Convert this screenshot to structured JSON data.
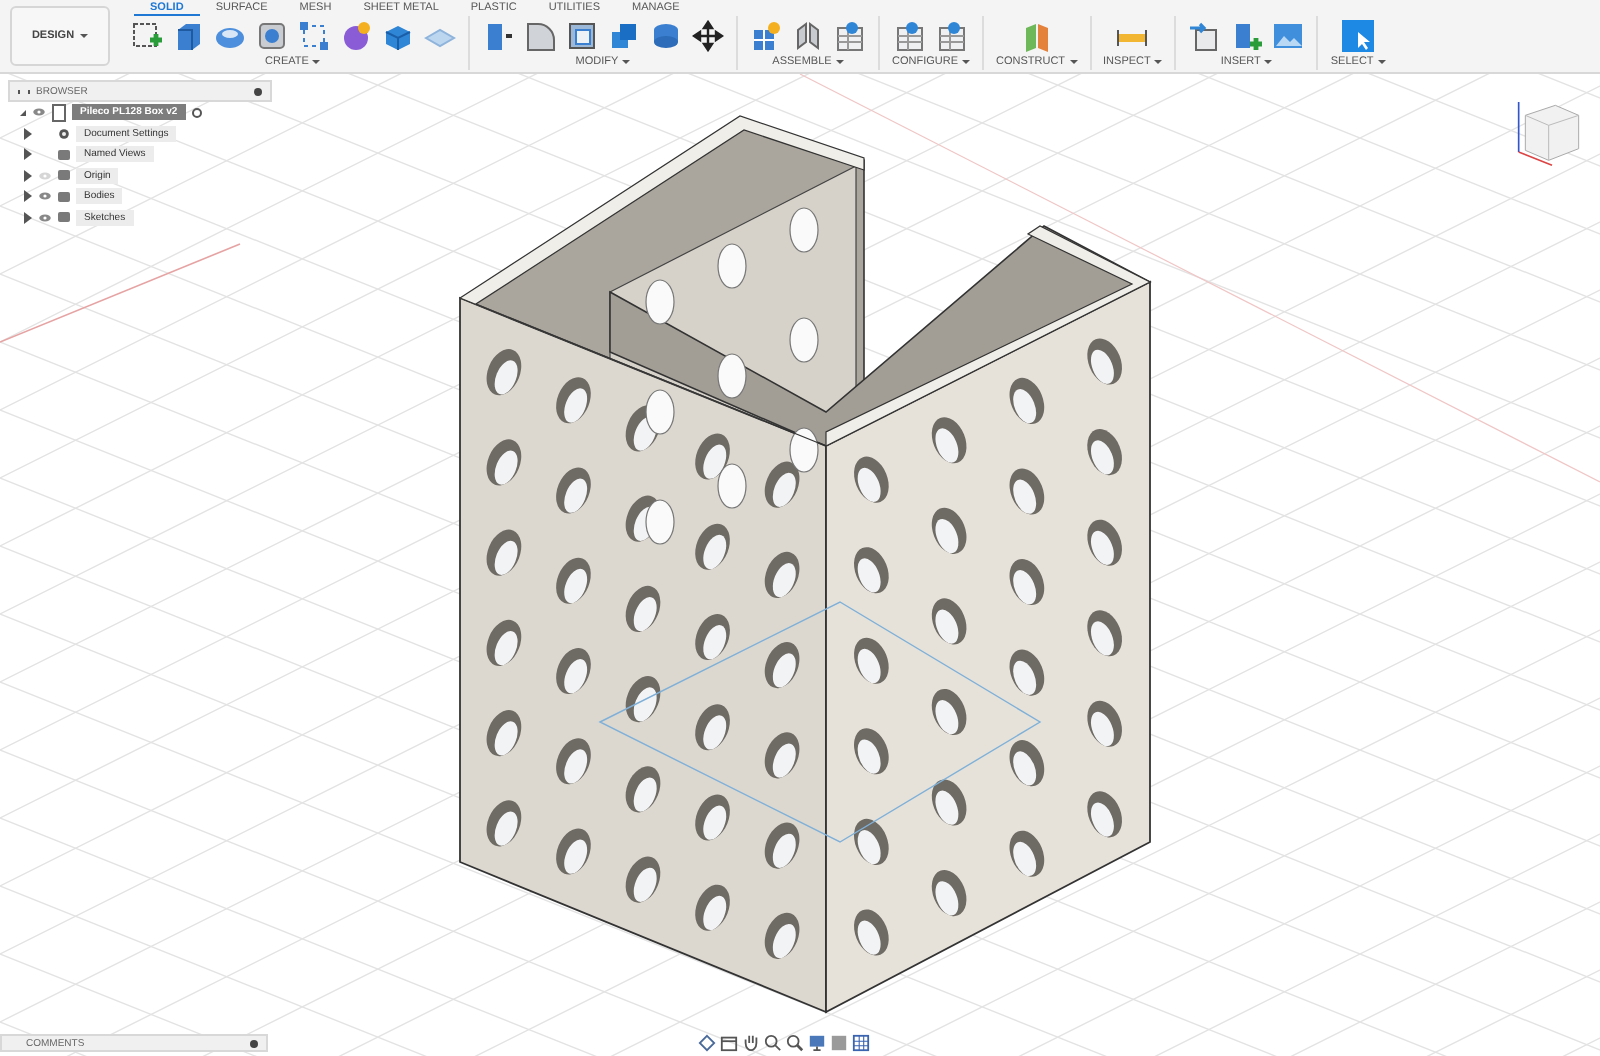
{
  "workspace": {
    "label": "DESIGN"
  },
  "tabs": [
    {
      "label": "SOLID",
      "selected": true
    },
    {
      "label": "SURFACE",
      "selected": false
    },
    {
      "label": "MESH",
      "selected": false
    },
    {
      "label": "SHEET METAL",
      "selected": false
    },
    {
      "label": "PLASTIC",
      "selected": false
    },
    {
      "label": "UTILITIES",
      "selected": false
    },
    {
      "label": "MANAGE",
      "selected": false
    }
  ],
  "tool_groups": [
    {
      "label": "CREATE"
    },
    {
      "label": "MODIFY"
    },
    {
      "label": "ASSEMBLE"
    },
    {
      "label": "CONFIGURE"
    },
    {
      "label": "CONSTRUCT"
    },
    {
      "label": "INSPECT"
    },
    {
      "label": "INSERT"
    },
    {
      "label": "SELECT"
    }
  ],
  "browser": {
    "title": "BROWSER",
    "root": {
      "label": "Pileco PL128 Box v2",
      "visible": true,
      "selected": true,
      "children": [
        {
          "label": "Document Settings",
          "kind": "settings",
          "selected": false
        },
        {
          "label": "Named Views",
          "kind": "views",
          "selected": false
        },
        {
          "label": "Origin",
          "kind": "object",
          "visible": false,
          "selected": false
        },
        {
          "label": "Bodies",
          "kind": "object",
          "visible": true,
          "selected": false
        },
        {
          "label": "Sketches",
          "kind": "object",
          "visible": true,
          "selected": false
        }
      ]
    }
  },
  "comments": {
    "title": "COMMENTS"
  }
}
